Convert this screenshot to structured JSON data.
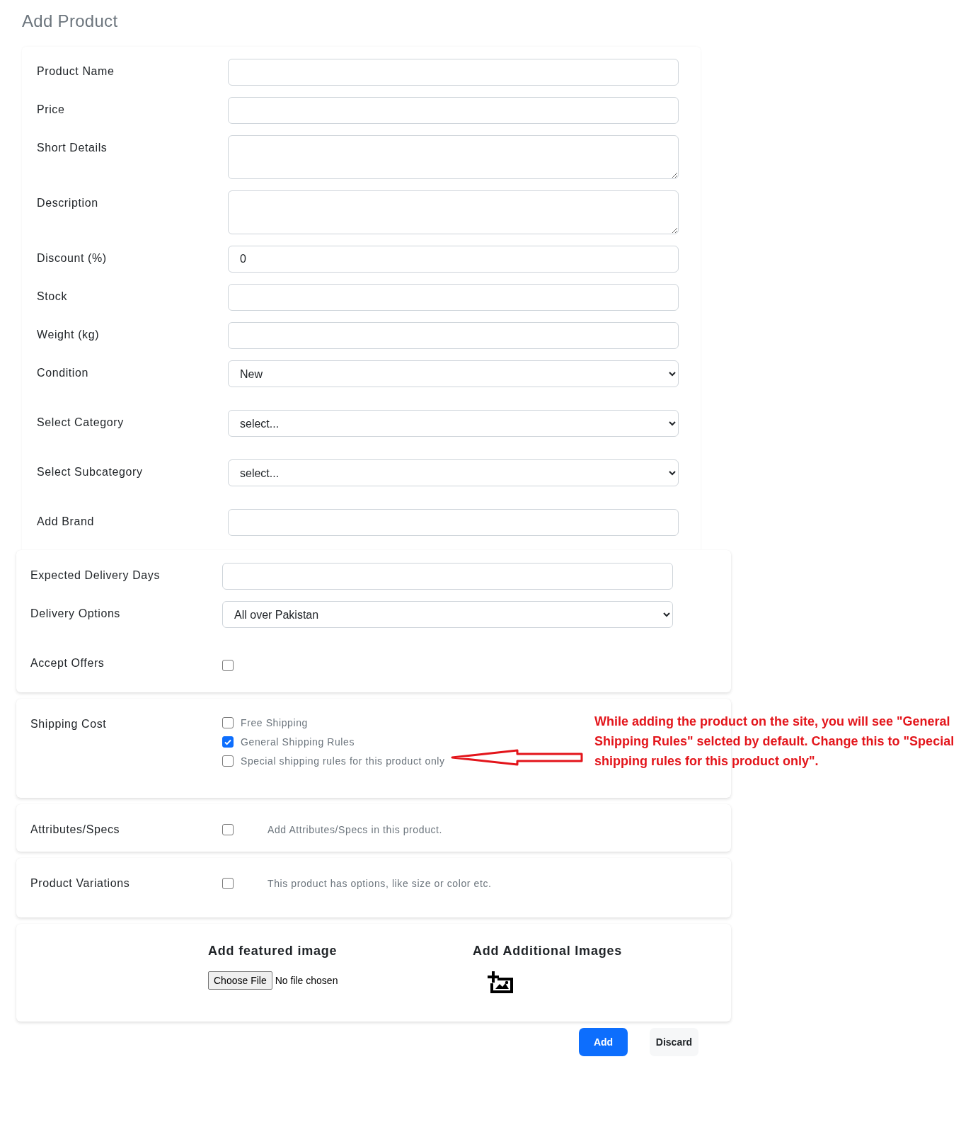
{
  "title": "Add Product",
  "product_fields": [
    {
      "label": "Product Name",
      "kind": "input"
    },
    {
      "label": "Price",
      "kind": "input"
    },
    {
      "label": "Short Details",
      "kind": "textarea"
    },
    {
      "label": "Description",
      "kind": "textarea"
    },
    {
      "label": "Discount (%)",
      "kind": "input",
      "value": "0"
    },
    {
      "label": "Stock",
      "kind": "input"
    },
    {
      "label": "Weight (kg)",
      "kind": "input"
    },
    {
      "label": "Condition",
      "kind": "select",
      "value": "New"
    },
    {
      "label": "Select Category",
      "kind": "select",
      "value": "select..."
    },
    {
      "label": "Select Subcategory",
      "kind": "select",
      "value": "select..."
    },
    {
      "label": "Add Brand",
      "kind": "input"
    }
  ],
  "delivery_fields": [
    {
      "label": "Expected Delivery Days",
      "kind": "input"
    },
    {
      "label": "Delivery Options",
      "kind": "select",
      "value": "All over Pakistan"
    },
    {
      "label": "Accept Offers",
      "kind": "checkbox",
      "checked": false
    }
  ],
  "shipping": {
    "label": "Shipping Cost",
    "options": [
      {
        "label": "Free Shipping",
        "checked": false
      },
      {
        "label": "General Shipping Rules",
        "checked": true
      },
      {
        "label": "Special shipping rules for this product only",
        "checked": false
      }
    ]
  },
  "annotation": "While adding the product on the site, you will see \"General Shipping Rules\" selcted by default. Change this to \"Special shipping rules for this product only\".",
  "toggles": [
    {
      "label": "Attributes/Specs",
      "checked": false,
      "hint": "Add Attributes/Specs in this product."
    },
    {
      "label": "Product Variations",
      "checked": false,
      "hint": "This product has options, like size or color etc."
    }
  ],
  "images": {
    "featured_title": "Add featured image",
    "file_button": "Choose File",
    "file_status": "No file chosen",
    "additional_title": "Add Additional Images"
  },
  "buttons": [
    {
      "label": "Add",
      "kind": "primary"
    },
    {
      "label": "Discard",
      "kind": "secondary"
    }
  ]
}
